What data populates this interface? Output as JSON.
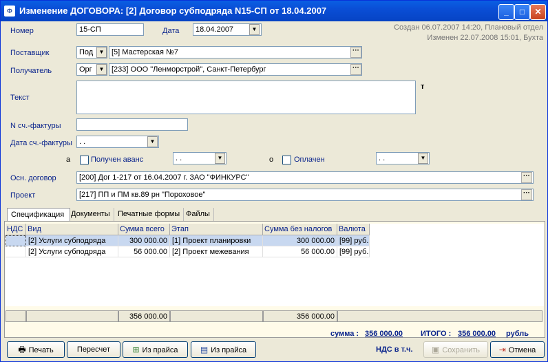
{
  "window": {
    "title": "Изменение ДОГОВОРА: [2]  Договор субподряда N15-СП от 18.04.2007",
    "app_icon": "Ф"
  },
  "form": {
    "nomer_label": "Номер",
    "nomer_value": "15-СП",
    "data_label": "Дата",
    "data_value": "18.04.2007",
    "created": "Создан 06.07.2007 14:20, Плановый отдел",
    "modified": "Изменен 22.07.2008 15:01, Бухта",
    "postavshik_label": "Поставщик",
    "postavshik_type": "Под",
    "postavshik_value": "[5]  Мастерская №7",
    "poluchatel_label": "Получатель",
    "poluchatel_type": "Орг",
    "poluchatel_value": "[233]  ООО \"Ленморстрой\", Санкт-Петербург",
    "tekst_label": "Текст",
    "tekst_marker": "т",
    "schet_label": "N сч.-фактуры",
    "data_schet_label": "Дата сч.-фактуры",
    "data_schet_value": ". .",
    "a_marker": "а",
    "avans_label": "Получен аванс",
    "avans_date": ". .",
    "o_marker": "о",
    "oplachen_label": "Оплачен",
    "oplachen_date": ". .",
    "osn_label": "Осн. договор",
    "osn_value": "[200]  Дог 1-217 от 16.04.2007 г.  ЗАО \"ФИНКУРС\"",
    "proekt_label": "Проект",
    "proekt_value": "[217] ПП и ПМ кв.89 рн \"Пороховое\""
  },
  "tabs": [
    "Спецификация",
    "Документы",
    "Печатные формы",
    "Файлы"
  ],
  "table": {
    "headers": [
      "НДС",
      "Вид",
      "Сумма всего",
      "Этап",
      "Сумма без налогов",
      "Валюта"
    ],
    "rows": [
      {
        "nds": "",
        "vid": "[2]  Услуги субподряда",
        "summa": "300 000.00",
        "etap": "[1] Проект планировки",
        "bez": "300 000.00",
        "val": "[99]  руб."
      },
      {
        "nds": "",
        "vid": "[2]  Услуги субподряда",
        "summa": "56 000.00",
        "etap": "[2] Проект межевания",
        "bez": "56 000.00",
        "val": "[99]  руб."
      }
    ],
    "footer_summa": "356 000.00",
    "footer_bez": "356 000.00"
  },
  "totals": {
    "summa_label": "сумма :",
    "summa_value": "356 000.00",
    "itogo_label": "ИТОГО :",
    "itogo_value": "356 000.00",
    "itogo_unit": "рубль",
    "nds_label": "НДС в т.ч."
  },
  "buttons": {
    "print": "Печать",
    "recalc": "Пересчет",
    "from_price1": "Из прайса",
    "from_price2": "Из прайса",
    "save": "Сохранить",
    "cancel": "Отмена"
  }
}
